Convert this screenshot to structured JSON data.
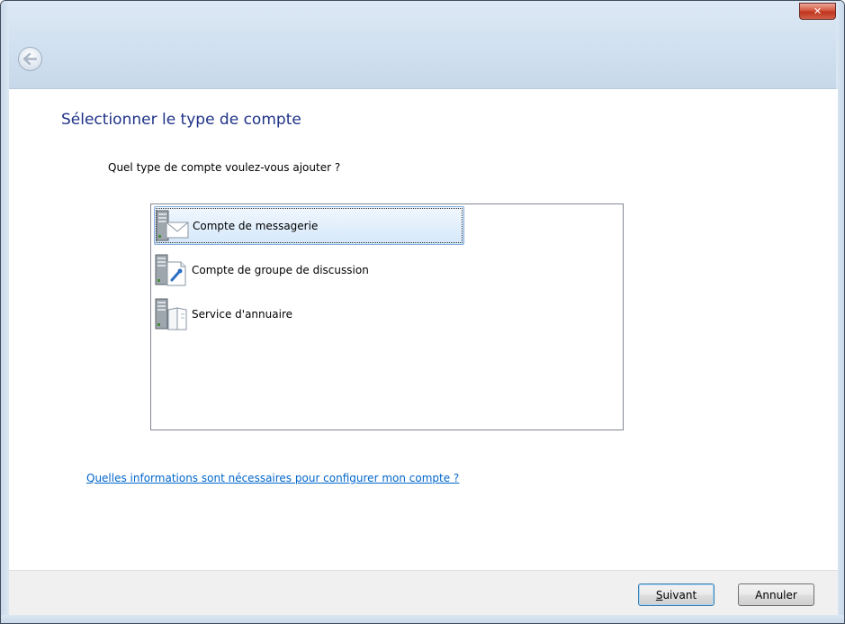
{
  "window": {
    "close_glyph": "✕"
  },
  "page": {
    "title": "Sélectionner le type de compte",
    "question": "Quel type de compte voulez-vous ajouter ?"
  },
  "account_types": [
    {
      "label": "Compte de messagerie",
      "icon": "mail-server-icon",
      "selected": true
    },
    {
      "label": "Compte de groupe de discussion",
      "icon": "newsgroup-server-icon",
      "selected": false
    },
    {
      "label": "Service d'annuaire",
      "icon": "directory-service-icon",
      "selected": false
    }
  ],
  "help_link": "Quelles informations sont nécessaires pour configurer mon compte ?",
  "footer": {
    "next_accesskey": "S",
    "next_rest": "uivant",
    "cancel_label": "Annuler"
  },
  "colors": {
    "title": "#1e3287",
    "link": "#0066cc",
    "selection_border": "#84acdd",
    "close_button": "#c0341d"
  }
}
